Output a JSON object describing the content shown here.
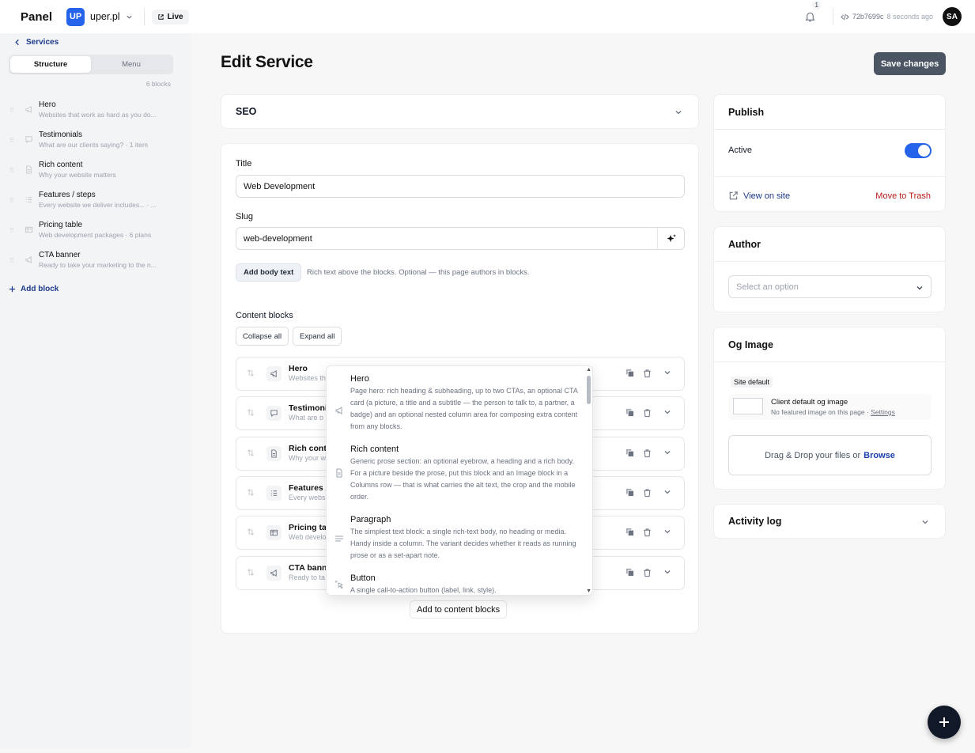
{
  "topbar": {
    "brand": "Panel",
    "workspace_initials": "UP",
    "workspace_name": "uper.pl",
    "live_label": "Live",
    "notification_count": "1",
    "commit_hash": "72b7699c",
    "commit_time": "8 seconds ago",
    "avatar_initials": "SA"
  },
  "sidebar": {
    "back_label": "Services",
    "tabs": [
      {
        "label": "Structure",
        "active": true
      },
      {
        "label": "Menu",
        "active": false
      }
    ],
    "block_count": "6 blocks",
    "items": [
      {
        "title": "Hero",
        "subtitle": "Websites that work as hard as you do...",
        "icon": "megaphone-icon"
      },
      {
        "title": "Testimonials",
        "subtitle": "What are our clients saying? · 1 item",
        "icon": "speech-bubble-icon"
      },
      {
        "title": "Rich content",
        "subtitle": "Why your website matters",
        "icon": "document-icon"
      },
      {
        "title": "Features / steps",
        "subtitle": "Every website we deliver includes... · ...",
        "icon": "list-icon"
      },
      {
        "title": "Pricing table",
        "subtitle": "Web development packages · 6 plans",
        "icon": "table-icon"
      },
      {
        "title": "CTA banner",
        "subtitle": "Ready to take your marketing to the n...",
        "icon": "megaphone-icon"
      }
    ],
    "add_block_label": "Add block"
  },
  "main": {
    "page_title": "Edit Service",
    "save_label": "Save changes",
    "seo_title": "SEO",
    "title_label": "Title",
    "title_value": "Web Development",
    "slug_label": "Slug",
    "slug_value": "web-development",
    "add_body_label": "Add body text",
    "add_body_hint": "Rich text above the blocks. Optional — this page authors in blocks.",
    "content_blocks_label": "Content blocks",
    "collapse_all": "Collapse all",
    "expand_all": "Expand all",
    "blocks": [
      {
        "title": "Hero",
        "subtitle": "Websites th",
        "icon": "megaphone-icon"
      },
      {
        "title": "Testimonia",
        "subtitle": "What are o",
        "icon": "speech-bubble-icon"
      },
      {
        "title": "Rich conte",
        "subtitle": "Why your w",
        "icon": "document-icon"
      },
      {
        "title": "Features /",
        "subtitle": "Every webs",
        "icon": "list-icon"
      },
      {
        "title": "Pricing tab",
        "subtitle": "Web develo",
        "icon": "table-icon"
      },
      {
        "title": "CTA banne",
        "subtitle": "Ready to ta",
        "icon": "megaphone-icon"
      }
    ],
    "add_to_blocks_label": "Add to content blocks"
  },
  "block_picker": {
    "options": [
      {
        "title": "Hero",
        "description": "Page hero: rich heading & subheading, up to two CTAs, an optional CTA card (a picture, a title and a subtitle — the person to talk to, a partner, a badge) and an optional nested column area for composing extra content from any blocks.",
        "icon": "megaphone-icon"
      },
      {
        "title": "Rich content",
        "description": "Generic prose section: an optional eyebrow, a heading and a rich body. For a picture beside the prose, put this block and an Image block in a Columns row — that is what carries the alt text, the crop and the mobile order.",
        "icon": "document-icon"
      },
      {
        "title": "Paragraph",
        "description": "The simplest text block: a single rich-text body, no heading or media. Handy inside a column. The variant decides whether it reads as running prose or as a set-apart note.",
        "icon": "lines-icon"
      },
      {
        "title": "Button",
        "description": "A single call-to-action button (label, link, style).",
        "icon": "pointer-click-icon"
      }
    ]
  },
  "publish": {
    "title": "Publish",
    "active_label": "Active",
    "active": true,
    "view_label": "View on site",
    "trash_label": "Move to Trash"
  },
  "author": {
    "title": "Author",
    "placeholder": "Select an option"
  },
  "og_image": {
    "title": "Og Image",
    "tag": "Site default",
    "default_title": "Client default og image",
    "default_note": "No featured image on this page · ",
    "settings_link": "Settings",
    "drop_text": "Drag & Drop your files or",
    "browse_label": "Browse"
  },
  "activity": {
    "title": "Activity log"
  },
  "colors": {
    "accent": "#2563eb",
    "link": "#1e3a8a",
    "danger": "#b91c1c",
    "save_button": "#4b5563"
  }
}
